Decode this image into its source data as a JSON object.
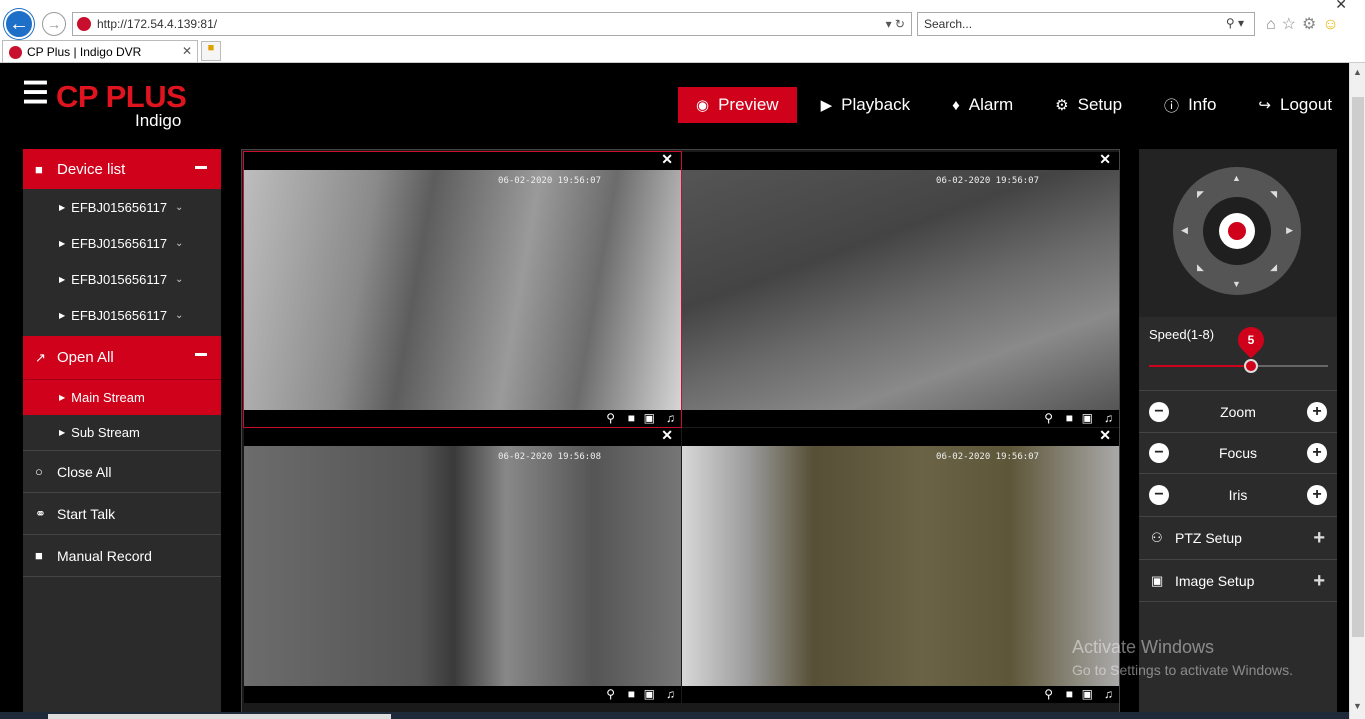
{
  "browser": {
    "url": "http://172.54.4.139:81/",
    "search_placeholder": "Search...",
    "tab_title": "CP Plus | Indigo DVR"
  },
  "brand": {
    "name": "CP PLUS",
    "sub": "Indigo"
  },
  "nav": {
    "preview": "Preview",
    "playback": "Playback",
    "alarm": "Alarm",
    "setup": "Setup",
    "info": "Info",
    "logout": "Logout"
  },
  "sidebar": {
    "device_list": "Device list",
    "devices": [
      "EFBJ015656117",
      "EFBJ015656117",
      "EFBJ015656117",
      "EFBJ015656117"
    ],
    "open_all": "Open All",
    "main_stream": "Main Stream",
    "sub_stream": "Sub Stream",
    "close_all": "Close All",
    "start_talk": "Start Talk",
    "manual_record": "Manual Record"
  },
  "cameras": [
    {
      "timestamp": "06-02-2020 19:56:07"
    },
    {
      "timestamp": "06-02-2020 19:56:07"
    },
    {
      "timestamp": "06-02-2020 19:56:08"
    },
    {
      "timestamp": "06-02-2020 19:56:07"
    }
  ],
  "ptz": {
    "speed_label": "Speed(1-8)",
    "speed_value": "5",
    "speed_min": 1,
    "speed_max": 8,
    "zoom": "Zoom",
    "focus": "Focus",
    "iris": "Iris",
    "ptz_setup": "PTZ Setup",
    "image_setup": "Image Setup"
  },
  "watermark": {
    "line1": "Activate Windows",
    "line2": "Go to Settings to activate Windows."
  },
  "colors": {
    "accent": "#d0021b",
    "panel": "#2b2b2b",
    "background": "#000000"
  }
}
